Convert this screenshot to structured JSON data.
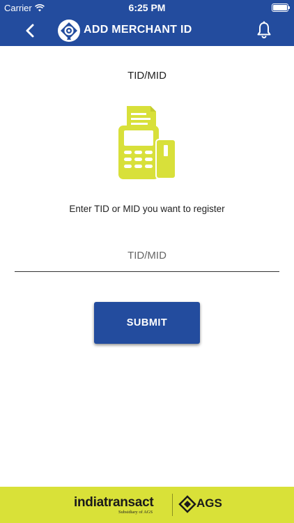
{
  "status_bar": {
    "carrier": "Carrier",
    "time": "6:25 PM"
  },
  "header": {
    "title": "ADD MERCHANT ID"
  },
  "main": {
    "section_label": "TID/MID",
    "instruction": "Enter TID or MID you want to register",
    "input": {
      "placeholder": "TID/MID",
      "value": ""
    },
    "submit_label": "SUBMIT"
  },
  "footer": {
    "brand": "indiatransact",
    "brand_sub": "Subsidiary of AGS",
    "partner": "AGS"
  },
  "colors": {
    "primary": "#234c9e",
    "accent": "#d9e138",
    "icon": "#d8e03a"
  }
}
